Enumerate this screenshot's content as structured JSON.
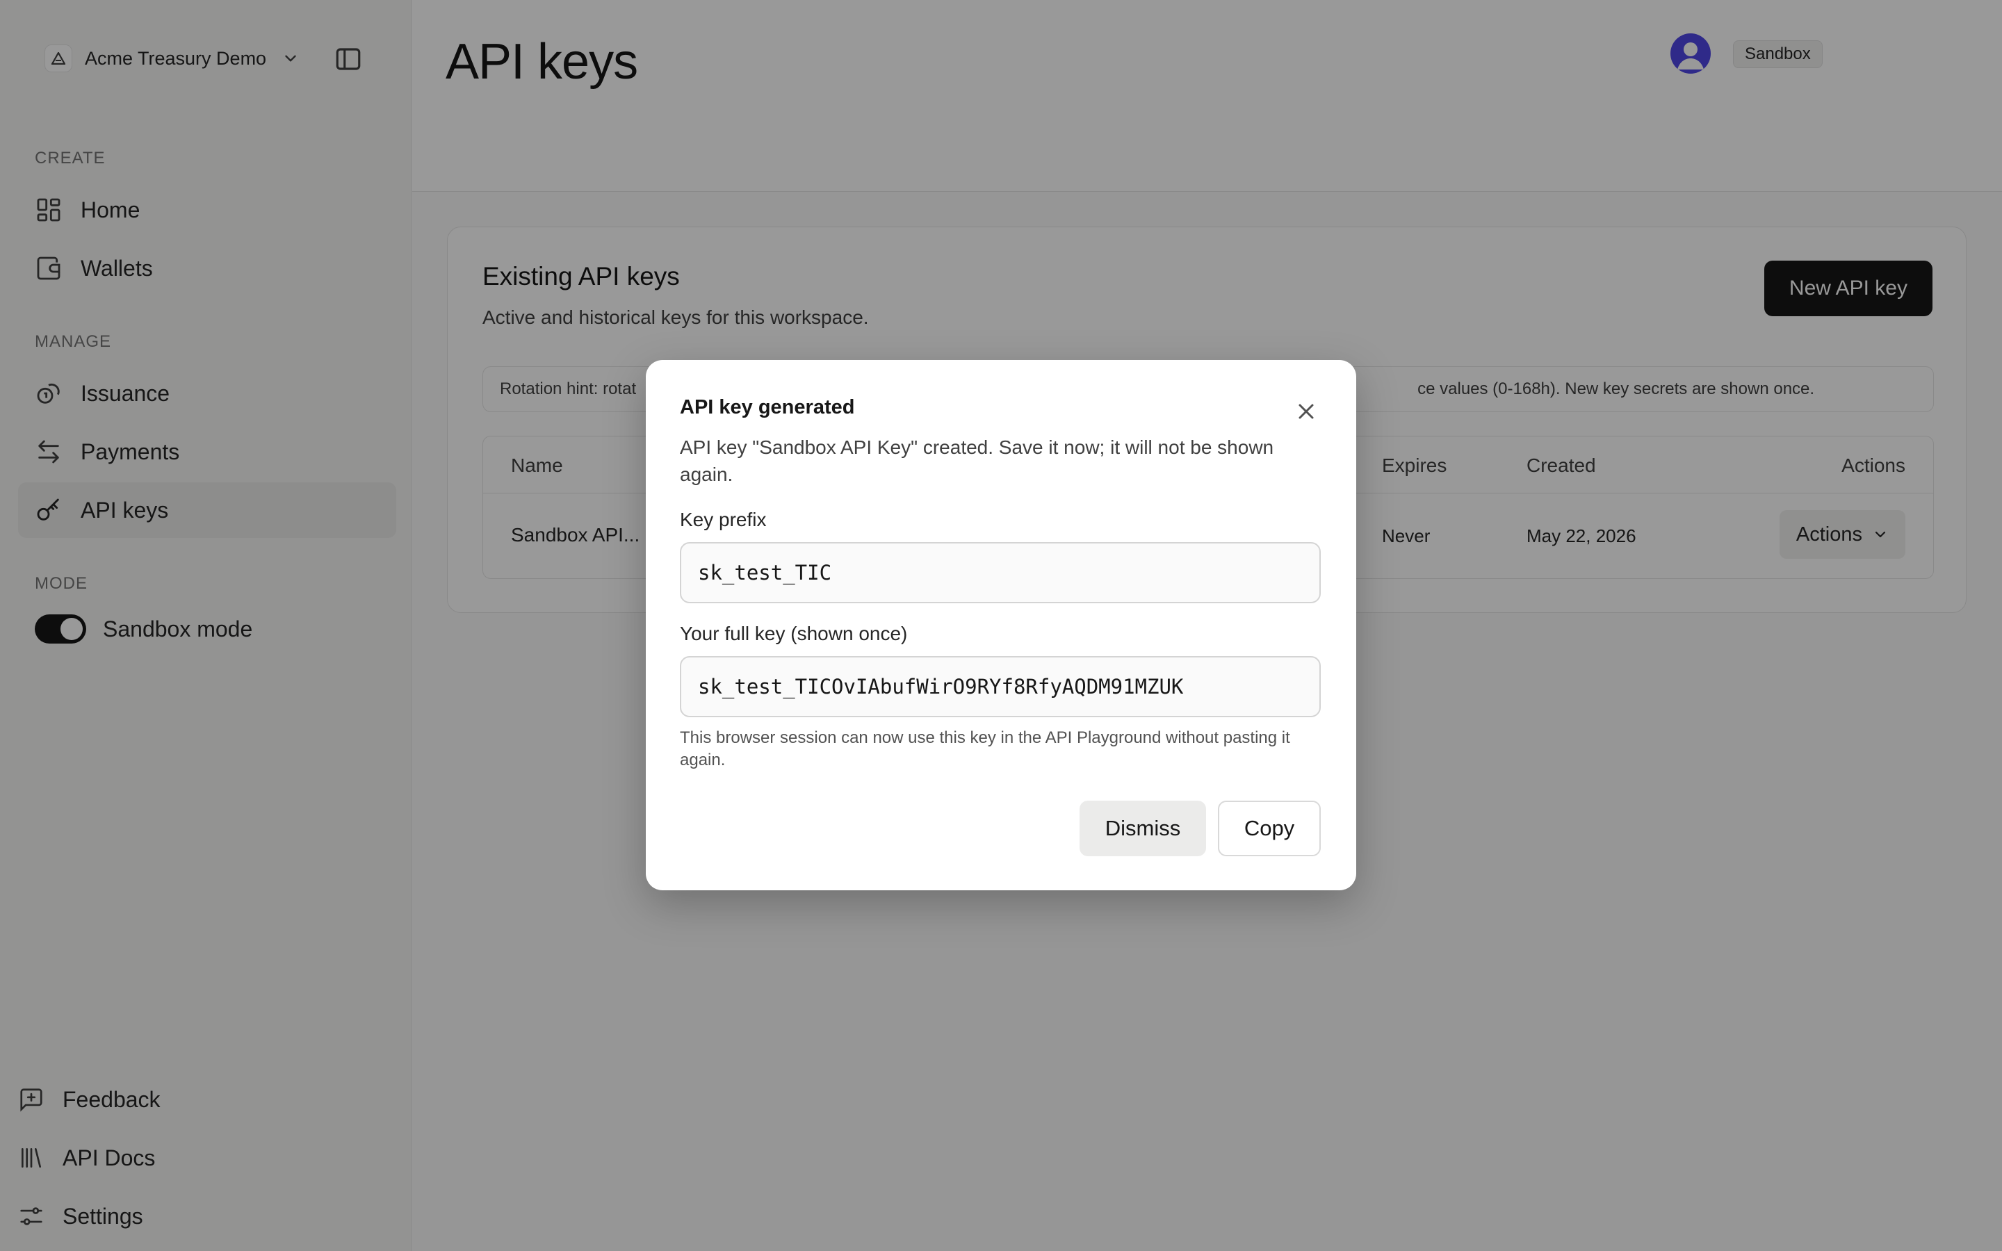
{
  "sidebar": {
    "workspace": "Acme Treasury Demo",
    "sections": {
      "create": "CREATE",
      "manage": "MANAGE",
      "mode": "MODE"
    },
    "items": {
      "home": "Home",
      "wallets": "Wallets",
      "issuance": "Issuance",
      "payments": "Payments",
      "api_keys": "API keys"
    },
    "mode_toggle": "Sandbox mode",
    "footer": {
      "feedback": "Feedback",
      "api_docs": "API Docs",
      "settings": "Settings"
    }
  },
  "header": {
    "title": "API keys",
    "env_badge": "Sandbox"
  },
  "card": {
    "title": "Existing API keys",
    "subtitle": "Active and historical keys for this workspace.",
    "new_button": "New API key",
    "hint_left": "Rotation hint: rotat",
    "hint_right": "ce values (0-168h). New key secrets are shown once.",
    "columns": {
      "name": "Name",
      "expires": "Expires",
      "created": "Created",
      "actions": "Actions"
    },
    "row": {
      "name": "Sandbox API...",
      "expires": "Never",
      "created": "May 22, 2026",
      "actions": "Actions"
    }
  },
  "modal": {
    "title": "API key generated",
    "description": "API key \"Sandbox API Key\" created. Save it now; it will not be shown again.",
    "prefix_label": "Key prefix",
    "prefix_value": "sk_test_TIC",
    "full_label": "Your full key (shown once)",
    "full_value": "sk_test_TICOvIAbufWirO9RYf8RfyAQDM91MZUK",
    "help": "This browser session can now use this key in the API Playground without pasting it again.",
    "dismiss": "Dismiss",
    "copy": "Copy"
  },
  "colors": {
    "accent": "#171717",
    "avatar": "#4f46e5",
    "overlay": "rgba(0,0,0,0.40)"
  }
}
